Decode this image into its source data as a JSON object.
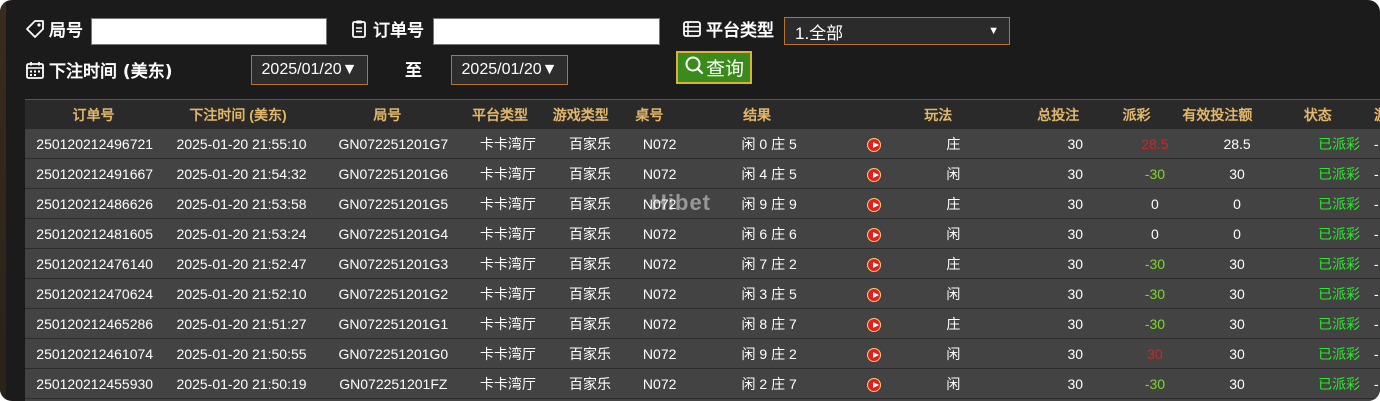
{
  "filters": {
    "round_label": "局号",
    "round_value": "",
    "order_label": "订单号",
    "order_value": "",
    "platform_label": "平台类型",
    "platform_selected": "1.全部",
    "bet_time_label": "下注时间 (美东)",
    "date_from": "2025/01/20▼",
    "date_to_label": "至",
    "date_to": "2025/01/20▼",
    "query_label": "查询"
  },
  "table": {
    "headers": [
      "订单号",
      "下注时间 (美东)",
      "局号",
      "平台类型",
      "游戏类型",
      "桌号",
      "结果",
      "玩法",
      "总投注",
      "派彩",
      "有效投注额",
      "状态",
      "游戏杉"
    ],
    "rows": [
      {
        "order": "250120212496721",
        "time": "2025-01-20 21:55:10",
        "round": "GN072251201G7",
        "platform": "卡卡湾厅",
        "game": "百家乐",
        "table": "N072",
        "result": "闲 0 庄 5",
        "play": "庄",
        "bet": "30",
        "payout": "28.5",
        "payout_type": "pos",
        "valid": "28.5",
        "status": "已派彩",
        "misc": "-"
      },
      {
        "order": "250120212491667",
        "time": "2025-01-20 21:54:32",
        "round": "GN072251201G6",
        "platform": "卡卡湾厅",
        "game": "百家乐",
        "table": "N072",
        "result": "闲 4 庄 5",
        "play": "闲",
        "bet": "30",
        "payout": "-30",
        "payout_type": "neg",
        "valid": "30",
        "status": "已派彩",
        "misc": "-"
      },
      {
        "order": "250120212486626",
        "time": "2025-01-20 21:53:58",
        "round": "GN072251201G5",
        "platform": "卡卡湾厅",
        "game": "百家乐",
        "table": "N072",
        "result": "闲 9 庄 9",
        "play": "庄",
        "bet": "30",
        "payout": "0",
        "payout_type": "zero",
        "valid": "0",
        "status": "已派彩",
        "misc": "-"
      },
      {
        "order": "250120212481605",
        "time": "2025-01-20 21:53:24",
        "round": "GN072251201G4",
        "platform": "卡卡湾厅",
        "game": "百家乐",
        "table": "N072",
        "result": "闲 6 庄 6",
        "play": "闲",
        "bet": "30",
        "payout": "0",
        "payout_type": "zero",
        "valid": "0",
        "status": "已派彩",
        "misc": "-"
      },
      {
        "order": "250120212476140",
        "time": "2025-01-20 21:52:47",
        "round": "GN072251201G3",
        "platform": "卡卡湾厅",
        "game": "百家乐",
        "table": "N072",
        "result": "闲 7 庄 2",
        "play": "庄",
        "bet": "30",
        "payout": "-30",
        "payout_type": "neg",
        "valid": "30",
        "status": "已派彩",
        "misc": "-"
      },
      {
        "order": "250120212470624",
        "time": "2025-01-20 21:52:10",
        "round": "GN072251201G2",
        "platform": "卡卡湾厅",
        "game": "百家乐",
        "table": "N072",
        "result": "闲 3 庄 5",
        "play": "闲",
        "bet": "30",
        "payout": "-30",
        "payout_type": "neg",
        "valid": "30",
        "status": "已派彩",
        "misc": "-"
      },
      {
        "order": "250120212465286",
        "time": "2025-01-20 21:51:27",
        "round": "GN072251201G1",
        "platform": "卡卡湾厅",
        "game": "百家乐",
        "table": "N072",
        "result": "闲 8 庄 7",
        "play": "庄",
        "bet": "30",
        "payout": "-30",
        "payout_type": "neg",
        "valid": "30",
        "status": "已派彩",
        "misc": "-"
      },
      {
        "order": "250120212461074",
        "time": "2025-01-20 21:50:55",
        "round": "GN072251201G0",
        "platform": "卡卡湾厅",
        "game": "百家乐",
        "table": "N072",
        "result": "闲 9 庄 2",
        "play": "闲",
        "bet": "30",
        "payout": "30",
        "payout_type": "pos",
        "valid": "30",
        "status": "已派彩",
        "misc": "-"
      },
      {
        "order": "250120212455930",
        "time": "2025-01-20 21:50:19",
        "round": "GN072251201FZ",
        "platform": "卡卡湾厅",
        "game": "百家乐",
        "table": "N072",
        "result": "闲 2 庄 7",
        "play": "闲",
        "bet": "30",
        "payout": "-30",
        "payout_type": "neg",
        "valid": "30",
        "status": "已派彩",
        "misc": "-"
      }
    ]
  },
  "watermark": "Hibet",
  "icons": {
    "round": "tag-icon",
    "order": "clipboard-icon",
    "platform": "list-icon",
    "date": "calendar-icon",
    "query": "search-icon",
    "video": "play-icon"
  },
  "colors": {
    "header_text": "#e3b76a",
    "payout_negative": "#7cd82a",
    "payout_positive": "#c42a2a",
    "status_done": "#2ee62e",
    "query_button": "#3b8a1c"
  }
}
